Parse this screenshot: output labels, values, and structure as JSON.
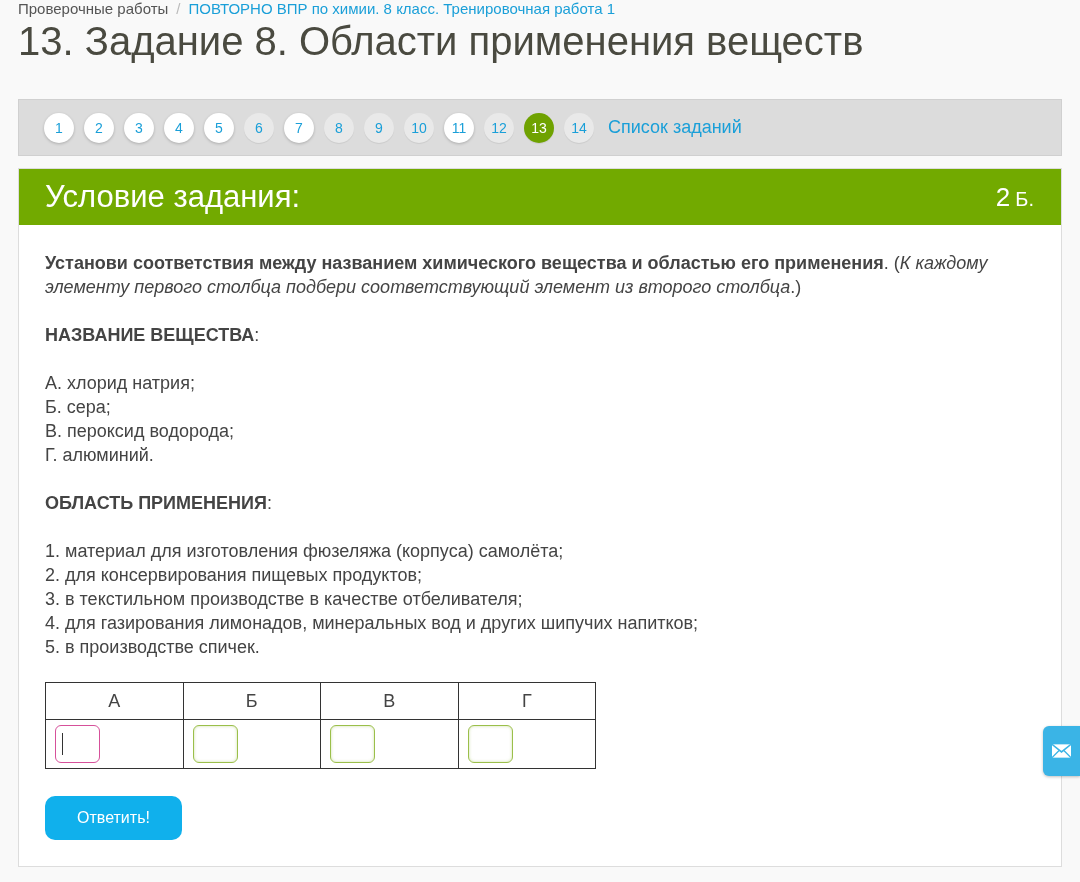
{
  "breadcrumb": {
    "separator": "/",
    "items": [
      {
        "label": "Проверочные работы",
        "link": false
      },
      {
        "label": "ПОВТОРНО ВПР по химии. 8 класс. Тренировочная работа 1",
        "link": true
      }
    ]
  },
  "title": "13. Задание 8. Области применения веществ",
  "pager": {
    "pages": [
      {
        "label": "1",
        "visited": true,
        "selected": false
      },
      {
        "label": "2",
        "visited": true,
        "selected": false
      },
      {
        "label": "3",
        "visited": true,
        "selected": false
      },
      {
        "label": "4",
        "visited": true,
        "selected": false
      },
      {
        "label": "5",
        "visited": true,
        "selected": false
      },
      {
        "label": "6",
        "visited": false,
        "selected": false
      },
      {
        "label": "7",
        "visited": true,
        "selected": false
      },
      {
        "label": "8",
        "visited": false,
        "selected": false
      },
      {
        "label": "9",
        "visited": false,
        "selected": false
      },
      {
        "label": "10",
        "visited": false,
        "selected": false
      },
      {
        "label": "11",
        "visited": true,
        "selected": false
      },
      {
        "label": "12",
        "visited": false,
        "selected": false
      },
      {
        "label": "13",
        "visited": false,
        "selected": true
      },
      {
        "label": "14",
        "visited": false,
        "selected": false
      }
    ],
    "task_list_link": "Список заданий"
  },
  "task": {
    "header": "Условие задания:",
    "points": "2",
    "points_unit": "Б.",
    "intro": "**Установи соответствия между названием химического вещества и областью его применения**. (*К каждому элементу первого столбца подбери соответствующий элемент из второго столбца*.)",
    "sections": [
      {
        "heading": "**НАЗВАНИЕ ВЕЩЕСТВА**:",
        "items": [
          "А. хлорид натрия;",
          "Б. сера;",
          "В. пероксид водорода;",
          "Г. алюминий."
        ]
      },
      {
        "heading": "**ОБЛАСТЬ ПРИМЕНЕНИЯ**:",
        "items": [
          "1. материал для изготовления фюзеляжа (корпуса) самолёта;",
          "2. для консервирования пищевых продуктов;",
          "3. в текстильном производстве в качестве отбеливателя;",
          "4. для газирования лимонадов, минеральных вод и других шипучих напитков;",
          "5. в производстве спичек."
        ]
      }
    ],
    "answer_table": {
      "columns": [
        "А",
        "Б",
        "В",
        "Г"
      ],
      "inputs": [
        {
          "focused": true
        },
        {
          "focused": false
        },
        {
          "focused": false
        },
        {
          "focused": false
        }
      ]
    },
    "submit_button": "Ответить!"
  }
}
